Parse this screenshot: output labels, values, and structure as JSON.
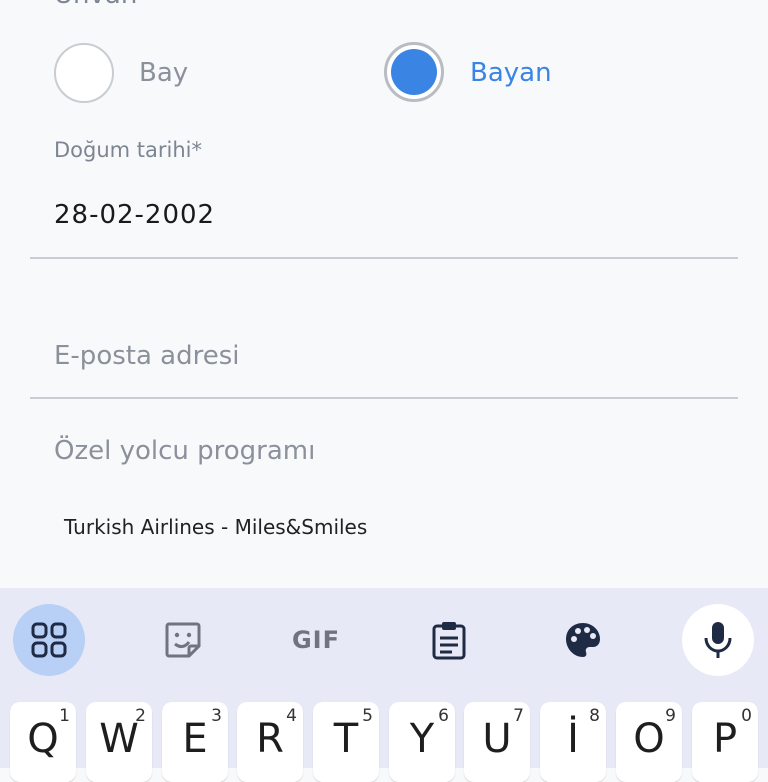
{
  "form": {
    "title_partial": "Unvan",
    "gender": {
      "options": [
        {
          "label": "Bay",
          "selected": false
        },
        {
          "label": "Bayan",
          "selected": true
        }
      ],
      "selected_color": "#3a85e4"
    },
    "birthdate": {
      "label": "Doğum tarihi*",
      "value": "28-02-2002"
    },
    "email": {
      "placeholder": "E-posta adresi"
    },
    "loyalty": {
      "label": "Özel yolcu programı",
      "value": "Turkish Airlines - Miles&Smiles"
    }
  },
  "keyboard": {
    "toolbar": [
      "apps-grid-icon",
      "sticker-icon",
      "gif-icon",
      "clipboard-icon",
      "palette-icon",
      "mic-icon"
    ],
    "gif_label": "GIF",
    "keys": [
      {
        "letter": "Q",
        "hint": "1"
      },
      {
        "letter": "W",
        "hint": "2"
      },
      {
        "letter": "E",
        "hint": "3"
      },
      {
        "letter": "R",
        "hint": "4"
      },
      {
        "letter": "T",
        "hint": "5"
      },
      {
        "letter": "Y",
        "hint": "6"
      },
      {
        "letter": "U",
        "hint": "7"
      },
      {
        "letter": "İ",
        "hint": "8"
      },
      {
        "letter": "O",
        "hint": "9"
      },
      {
        "letter": "P",
        "hint": "0"
      }
    ]
  }
}
